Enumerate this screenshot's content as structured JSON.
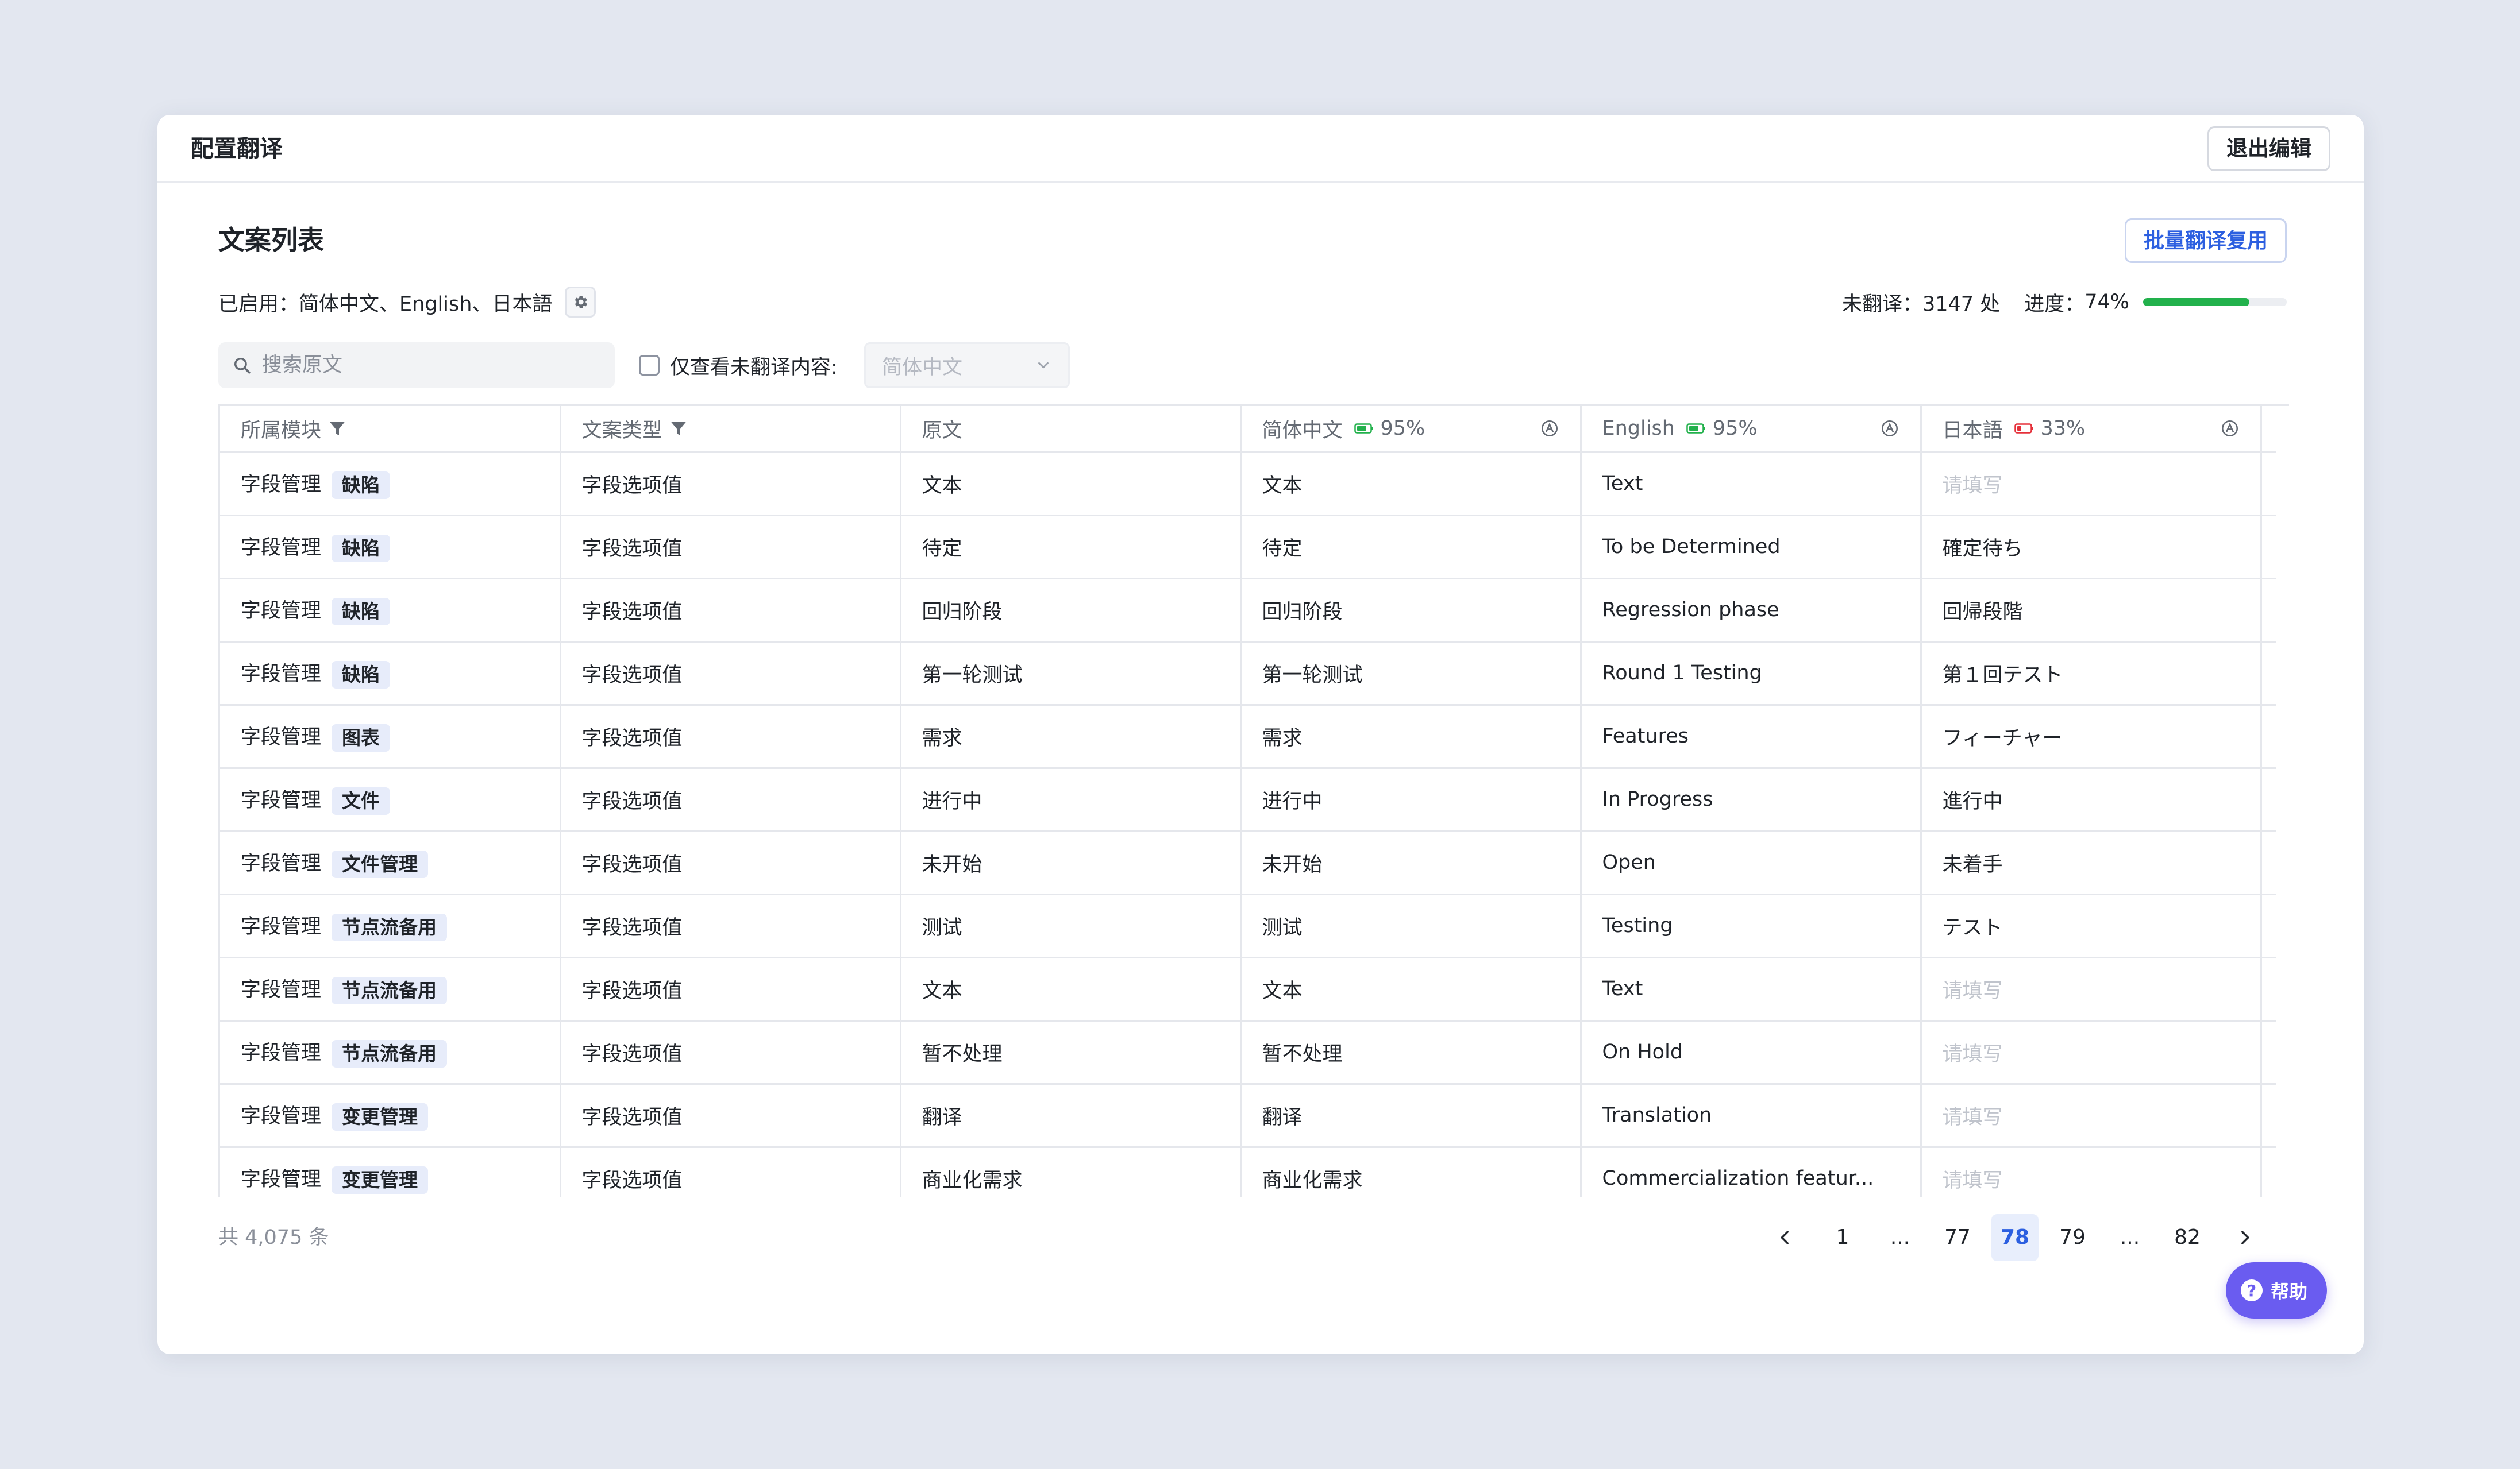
{
  "header": {
    "title": "配置翻译",
    "exit_label": "退出编辑"
  },
  "section": {
    "title": "文案列表",
    "batch_label": "批量翻译复用"
  },
  "enabled": {
    "label": "已启用：",
    "languages": "简体中文、English、日本語"
  },
  "progress": {
    "untranslated_label": "未翻译：",
    "untranslated_value": "3147 处",
    "progress_label": "进度：",
    "progress_value": "74%",
    "fraction": 0.74
  },
  "filters": {
    "search_placeholder": "搜索原文",
    "untranslated_only_label": "仅查看未翻译内容:",
    "language_select_value": "简体中文"
  },
  "colors": {
    "accent": "#2c5fe0",
    "progress": "#22b14c",
    "badge_ok": "#22b14c",
    "badge_low": "#e5303a",
    "help": "#6a5cf0"
  },
  "table": {
    "columns": [
      {
        "label": "所属模块"
      },
      {
        "label": "文案类型"
      },
      {
        "label": "原文"
      },
      {
        "label": "简体中文",
        "pct": "95%"
      },
      {
        "label": "English",
        "pct": "95%"
      },
      {
        "label": "日本語",
        "pct": "33%"
      }
    ],
    "rows": [
      {
        "module": "字段管理",
        "tag": "缺陷",
        "type": "字段选项值",
        "source": "文本",
        "zh": "文本",
        "en": "Text",
        "ja": "请填写"
      },
      {
        "module": "字段管理",
        "tag": "缺陷",
        "type": "字段选项值",
        "source": "待定",
        "zh": "待定",
        "en": "To be Determined",
        "ja": "確定待ち"
      },
      {
        "module": "字段管理",
        "tag": "缺陷",
        "type": "字段选项值",
        "source": "回归阶段",
        "zh": "回归阶段",
        "en": "Regression phase",
        "ja": "回帰段階"
      },
      {
        "module": "字段管理",
        "tag": "缺陷",
        "type": "字段选项值",
        "source": "第一轮测试",
        "zh": "第一轮测试",
        "en": "Round 1 Testing",
        "ja": "第１回テスト"
      },
      {
        "module": "字段管理",
        "tag": "图表",
        "type": "字段选项值",
        "source": "需求",
        "zh": "需求",
        "en": "Features",
        "ja": "フィーチャー"
      },
      {
        "module": "字段管理",
        "tag": "文件",
        "type": "字段选项值",
        "source": "进行中",
        "zh": "进行中",
        "en": "In Progress",
        "ja": "進行中"
      },
      {
        "module": "字段管理",
        "tag": "文件管理",
        "type": "字段选项值",
        "source": "未开始",
        "zh": "未开始",
        "en": "Open",
        "ja": "未着手"
      },
      {
        "module": "字段管理",
        "tag": "节点流备用",
        "type": "字段选项值",
        "source": "测试",
        "zh": "测试",
        "en": "Testing",
        "ja": "テスト"
      },
      {
        "module": "字段管理",
        "tag": "节点流备用",
        "type": "字段选项值",
        "source": "文本",
        "zh": "文本",
        "en": "Text",
        "ja": "请填写"
      },
      {
        "module": "字段管理",
        "tag": "节点流备用",
        "type": "字段选项值",
        "source": "暂不处理",
        "zh": "暂不处理",
        "en": "On Hold",
        "ja": "请填写"
      },
      {
        "module": "字段管理",
        "tag": "变更管理",
        "type": "字段选项值",
        "source": "翻译",
        "zh": "翻译",
        "en": "Translation",
        "ja": "请填写"
      },
      {
        "module": "字段管理",
        "tag": "变更管理",
        "type": "字段选项值",
        "source": "商业化需求",
        "zh": "商业化需求",
        "en": "Commercialization featur...",
        "ja": "请填写"
      }
    ]
  },
  "footer": {
    "total": "共 4,075 条",
    "pages": [
      "1",
      "...",
      "77",
      "78",
      "79",
      "...",
      "82"
    ],
    "active_page": "78",
    "help_label": "帮助"
  }
}
